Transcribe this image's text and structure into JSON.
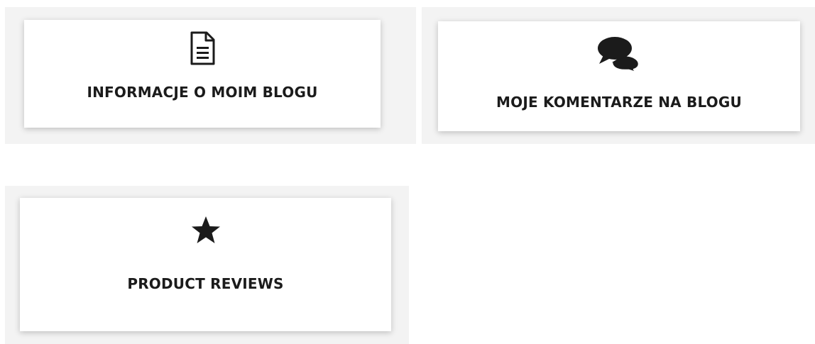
{
  "cards": [
    {
      "label": "INFORMACJE O MOIM BLOGU",
      "icon": "document-icon"
    },
    {
      "label": "MOJE KOMENTARZE NA BLOGU",
      "icon": "comments-icon"
    },
    {
      "label": "PRODUCT REVIEWS",
      "icon": "star-icon"
    }
  ],
  "colors": {
    "panel_background": "#f3f3f3",
    "card_background": "#ffffff",
    "text": "#1b1b1b",
    "icon": "#1b1b1b"
  }
}
